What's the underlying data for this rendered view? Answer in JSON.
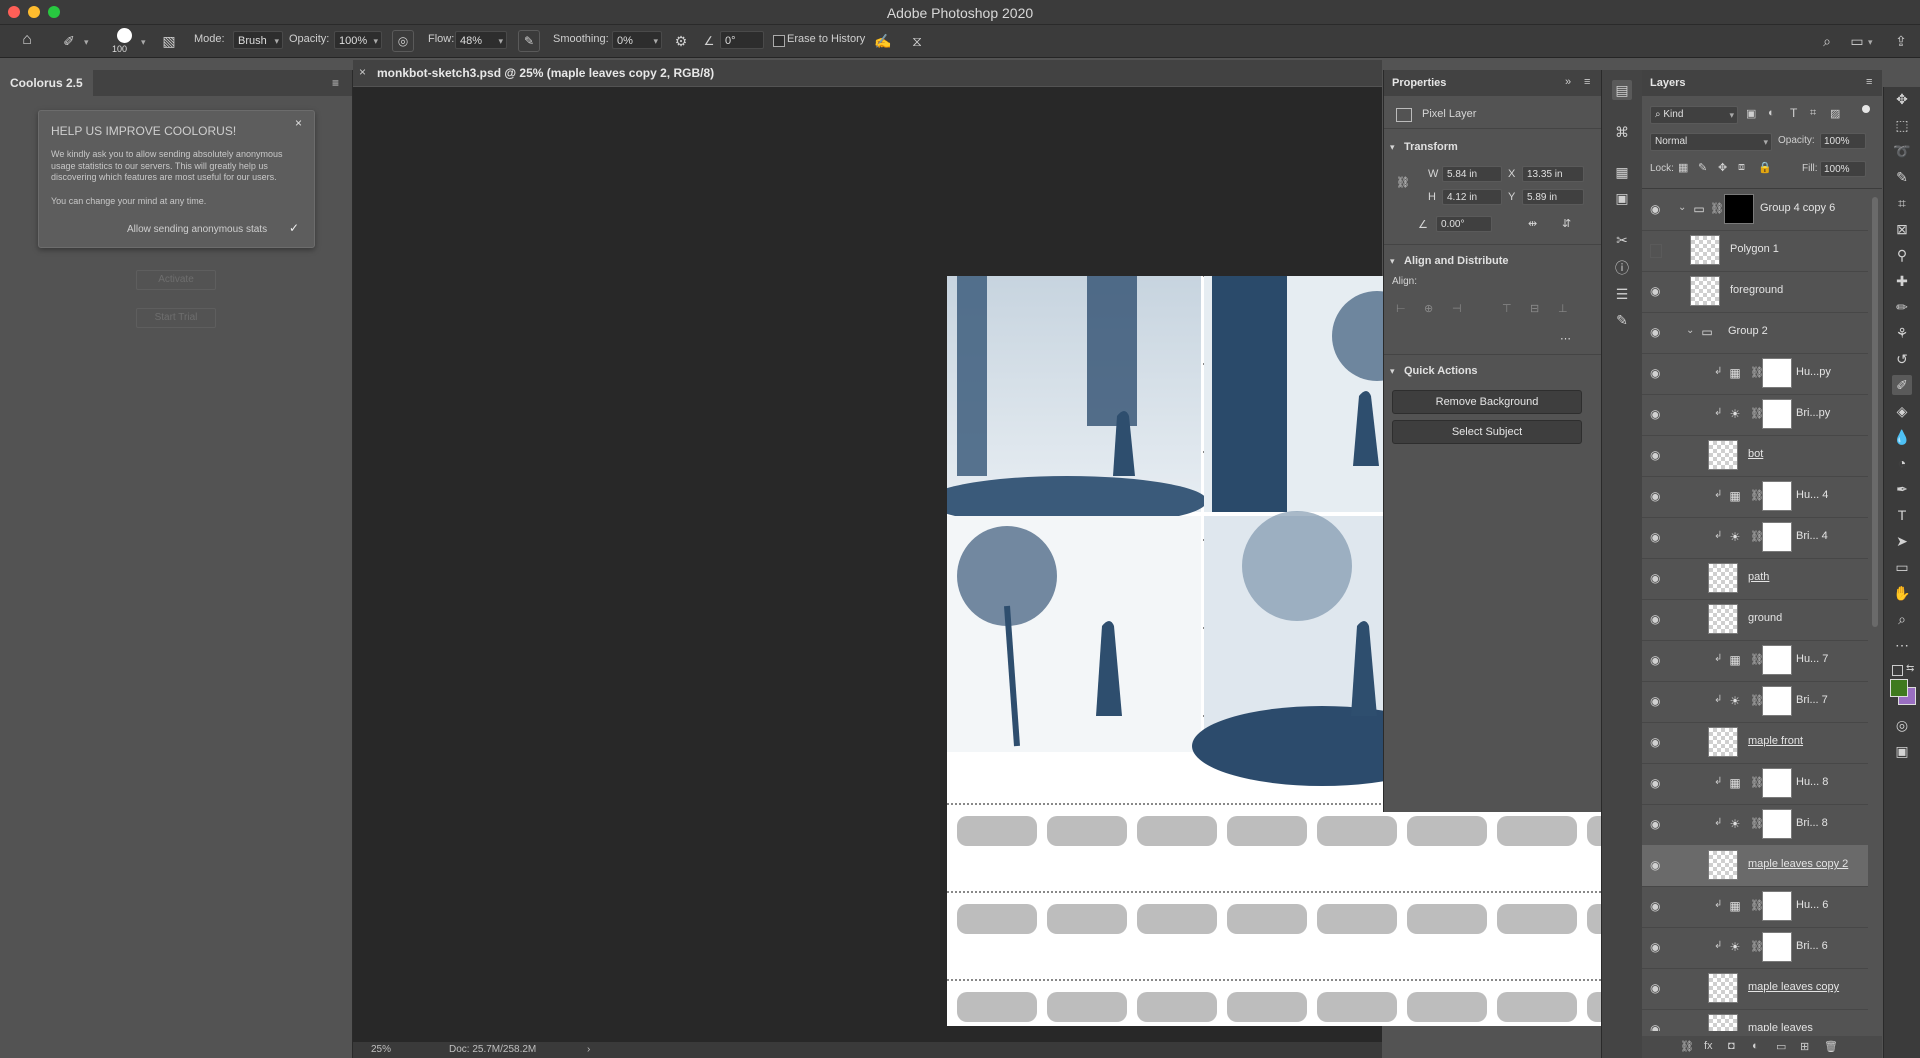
{
  "app": {
    "window_title": "Adobe Photoshop 2020"
  },
  "options_bar": {
    "brush_size": "100",
    "mode_label": "Mode:",
    "mode_value": "Brush",
    "opacity_label": "Opacity:",
    "opacity_value": "100%",
    "flow_label": "Flow:",
    "flow_value": "48%",
    "smoothing_label": "Smoothing:",
    "smoothing_value": "0%",
    "angle_value": "0°",
    "erase_history_label": "Erase to History"
  },
  "left_panel": {
    "tab_label": "Coolorus 2.5",
    "dialog": {
      "title": "HELP US IMPROVE COOLORUS!",
      "body": "We kindly ask you to allow sending absolutely anonymous usage statistics to our servers. This will greatly help us discovering which features are most useful for our users.",
      "body2": "You can change your mind at any time.",
      "checkbox_label": "Allow sending anonymous stats",
      "checked": true
    },
    "activate_label": "Activate",
    "start_trial_label": "Start Trial"
  },
  "document": {
    "tab_title": "monkbot-sketch3.psd @ 25% (maple leaves copy 2, RGB/8)",
    "zoom": "25%",
    "doc_size": "Doc: 25.7M/258.2M"
  },
  "properties": {
    "panel_title": "Properties",
    "layer_type": "Pixel Layer",
    "transform_title": "Transform",
    "w_label": "W",
    "w_value": "5.84 in",
    "x_label": "X",
    "x_value": "13.35 in",
    "h_label": "H",
    "h_value": "4.12 in",
    "y_label": "Y",
    "y_value": "5.89 in",
    "angle_value": "0.00°",
    "align_title": "Align and Distribute",
    "align_label": "Align:",
    "quick_actions_title": "Quick Actions",
    "remove_bg_label": "Remove Background",
    "select_subject_label": "Select Subject"
  },
  "layers": {
    "panel_title": "Layers",
    "filter_kind": "Kind",
    "blend_mode": "Normal",
    "opacity_label": "Opacity:",
    "opacity_value": "100%",
    "lock_label": "Lock:",
    "fill_label": "Fill:",
    "fill_value": "100%",
    "rows": [
      {
        "name": "Group 4 copy 6",
        "kind": "group-mask",
        "visible": true
      },
      {
        "name": "Polygon 1",
        "kind": "shape",
        "visible": false
      },
      {
        "name": "foreground",
        "kind": "pixel",
        "visible": true
      },
      {
        "name": "Group 2",
        "kind": "group",
        "visible": true
      },
      {
        "name": "Hu...py",
        "kind": "huesat",
        "visible": true
      },
      {
        "name": "Bri...py",
        "kind": "brightness",
        "visible": true
      },
      {
        "name": "bot",
        "kind": "pixel",
        "visible": true,
        "underline": true
      },
      {
        "name": "Hu... 4",
        "kind": "huesat",
        "visible": true
      },
      {
        "name": "Bri... 4",
        "kind": "brightness",
        "visible": true
      },
      {
        "name": "path",
        "kind": "pixel",
        "visible": true,
        "underline": true
      },
      {
        "name": "ground",
        "kind": "pixel",
        "visible": true
      },
      {
        "name": "Hu... 7",
        "kind": "huesat",
        "visible": true
      },
      {
        "name": "Bri... 7",
        "kind": "brightness",
        "visible": true
      },
      {
        "name": "maple front",
        "kind": "pixel",
        "visible": true,
        "underline": true
      },
      {
        "name": "Hu... 8",
        "kind": "huesat",
        "visible": true
      },
      {
        "name": "Bri... 8",
        "kind": "brightness",
        "visible": true
      },
      {
        "name": "maple leaves copy 2",
        "kind": "pixel",
        "visible": true,
        "underline": true,
        "selected": true
      },
      {
        "name": "Hu... 6",
        "kind": "huesat",
        "visible": true
      },
      {
        "name": "Bri... 6",
        "kind": "brightness",
        "visible": true
      },
      {
        "name": "maple leaves copy",
        "kind": "pixel",
        "visible": true,
        "underline": true
      },
      {
        "name": "maple leaves",
        "kind": "pixel",
        "visible": true
      }
    ]
  },
  "colors": {
    "foreground": "#3f7a1e",
    "background": "#9a6fc2"
  }
}
